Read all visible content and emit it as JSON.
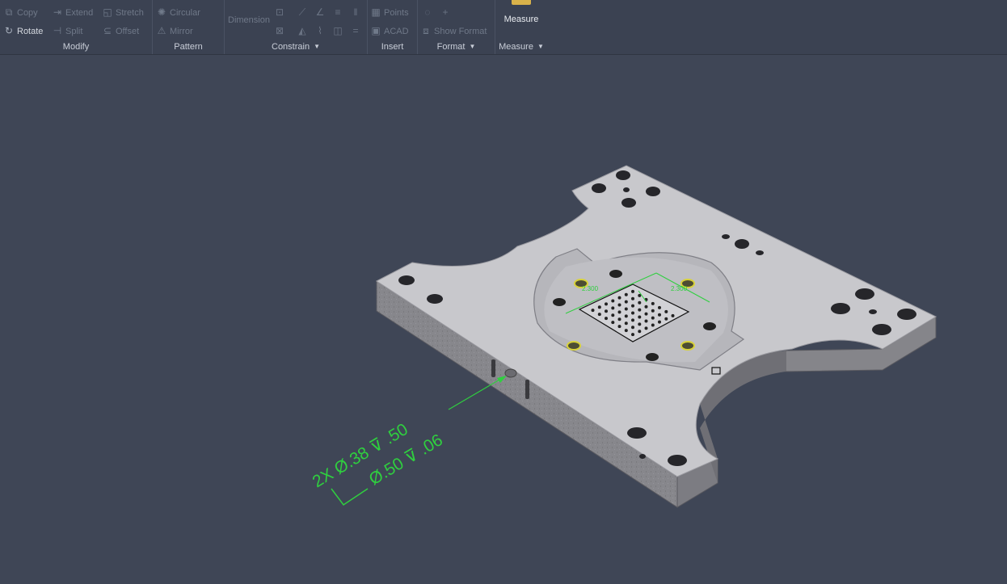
{
  "ribbon": {
    "modify": {
      "title": "Modify",
      "copy": "Copy",
      "extend": "Extend",
      "stretch": "Stretch",
      "rotate": "Rotate",
      "split": "Split",
      "offset": "Offset"
    },
    "pattern": {
      "title": "Pattern",
      "circular": "Circular",
      "mirror": "Mirror"
    },
    "constrain": {
      "title": "Constrain",
      "dimension": "Dimension"
    },
    "insert": {
      "title": "Insert",
      "points": "Points",
      "acad": "ACAD"
    },
    "format": {
      "title": "Format",
      "show_format": "Show Format"
    },
    "measure": {
      "title": "Measure",
      "button": "Measure"
    }
  },
  "viewport": {
    "annotation": {
      "line1": "2X Ø.38 ⊽ .50",
      "line2": "Ø.50 ⊽ .06",
      "color": "#2fcf3f"
    },
    "sketch_dimensions": [
      "2.300",
      "2.300"
    ]
  },
  "colors": {
    "background": "#3f4656",
    "part_top": "#c9c9cd",
    "part_side": "#8b8b90"
  }
}
